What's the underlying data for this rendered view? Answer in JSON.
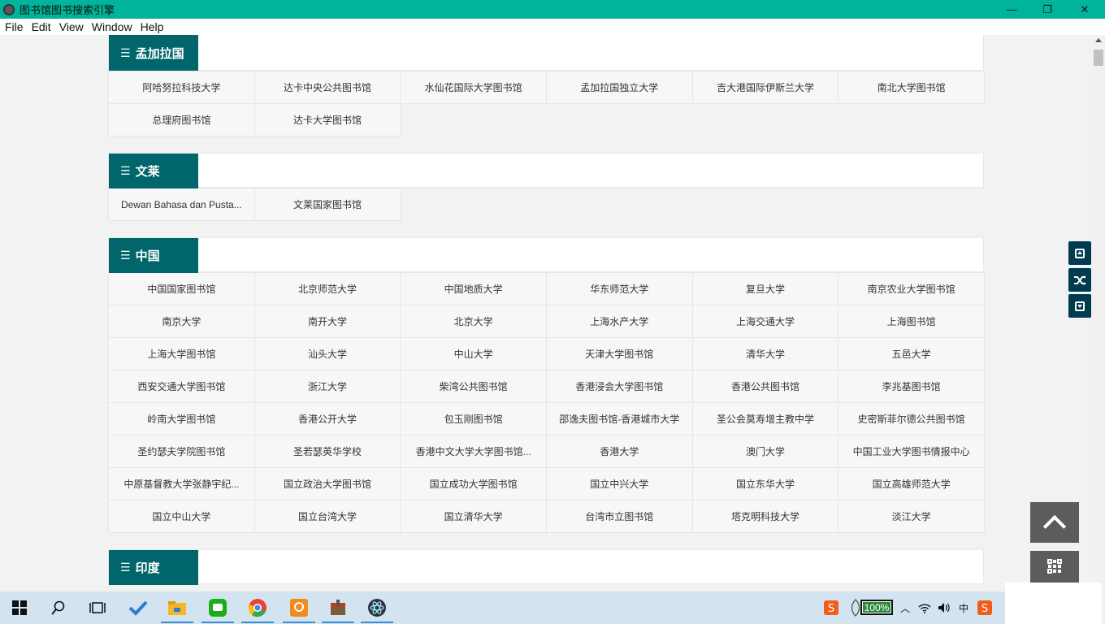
{
  "window": {
    "title": "图书馆图书搜索引擎",
    "minimize_glyph": "—",
    "maximize_glyph": "❐",
    "close_glyph": "✕"
  },
  "menu": [
    "File",
    "Edit",
    "View",
    "Window",
    "Help"
  ],
  "sections": [
    {
      "title": "孟加拉国",
      "items": [
        "阿哈努拉科技大学",
        "达卡中央公共图书馆",
        "水仙花国际大学图书馆",
        "孟加拉国独立大学",
        "吉大港国际伊斯兰大学",
        "南北大学图书馆",
        "总理府图书馆",
        "达卡大学图书馆"
      ]
    },
    {
      "title": "文莱",
      "items": [
        "Dewan Bahasa dan Pusta...",
        "文莱国家图书馆"
      ]
    },
    {
      "title": "中国",
      "items": [
        "中国国家图书馆",
        "北京师范大学",
        "中国地质大学",
        "华东师范大学",
        "复旦大学",
        "南京农业大学图书馆",
        "南京大学",
        "南开大学",
        "北京大学",
        "上海水产大学",
        "上海交通大学",
        "上海图书馆",
        "上海大学图书馆",
        "汕头大学",
        "中山大学",
        "天津大学图书馆",
        "清华大学",
        "五邑大学",
        "西安交通大学图书馆",
        "浙江大学",
        "柴湾公共图书馆",
        "香港浸会大学图书馆",
        "香港公共图书馆",
        "李兆基图书馆",
        "岭南大学图书馆",
        "香港公开大学",
        "包玉刚图书馆",
        "邵逸夫图书馆-香港城市大学",
        "圣公会莫寿增主教中学",
        "史密斯菲尔德公共图书馆",
        "圣约瑟夫学院图书馆",
        "圣若瑟英华学校",
        "香港中文大学大学图书馆...",
        "香港大学",
        "澳门大学",
        "中国工业大学图书情报中心",
        "中原基督教大学张静宇纪...",
        "国立政治大学图书馆",
        "国立成功大学图书馆",
        "国立中兴大学",
        "国立东华大学",
        "国立高雄师范大学",
        "国立中山大学",
        "国立台湾大学",
        "国立清华大学",
        "台湾市立图书馆",
        "塔克明科技大学",
        "淡江大学"
      ]
    },
    {
      "title": "印度",
      "items": []
    }
  ],
  "side_buttons": [
    "page-up-icon",
    "shuffle-icon",
    "page-down-icon"
  ],
  "taskbar": {
    "battery": "100%",
    "ime": "中"
  },
  "colors": {
    "titlebar": "#00b39a",
    "section_tag": "#00666b",
    "side_button": "#003b4f"
  }
}
